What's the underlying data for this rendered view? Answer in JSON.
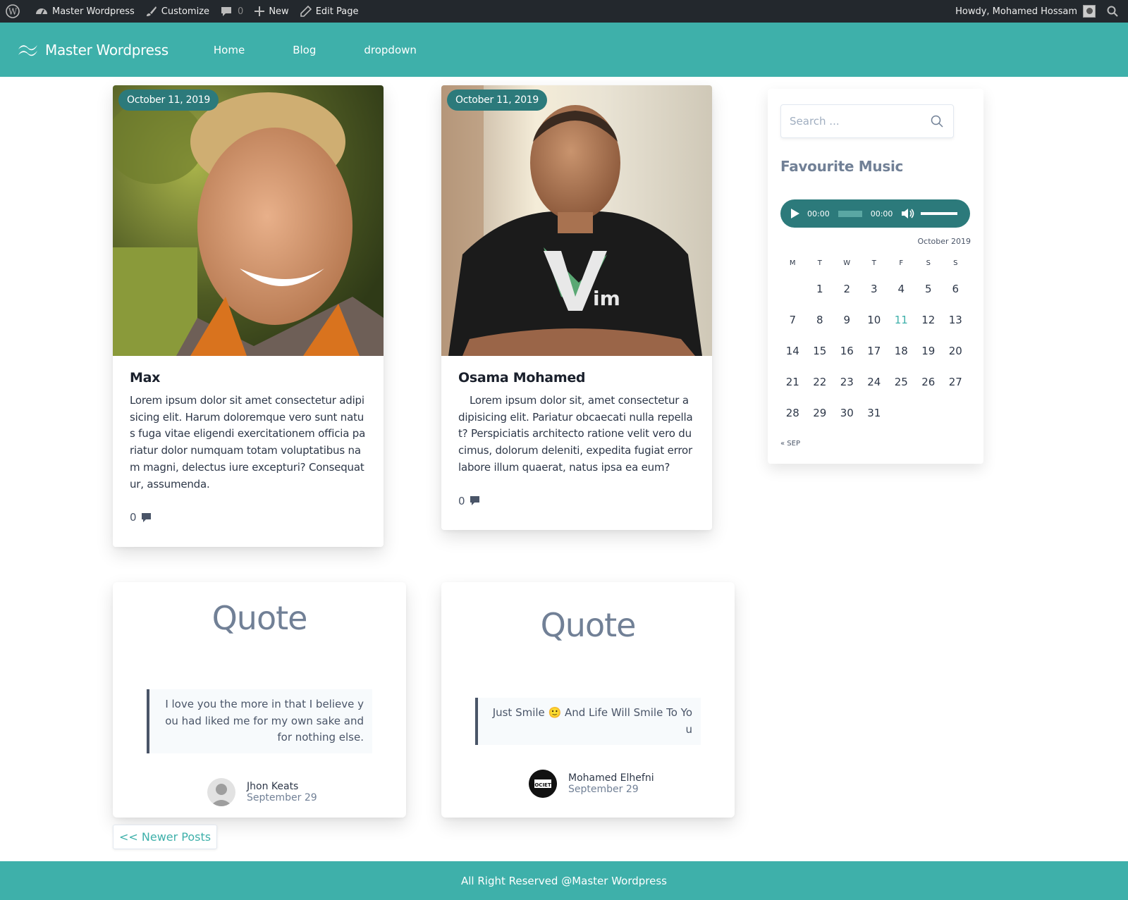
{
  "adminbar": {
    "site_name": "Master Wordpress",
    "customize": "Customize",
    "comments_count": "0",
    "new": "New",
    "edit_page": "Edit Page",
    "howdy": "Howdy, Mohamed Hossam"
  },
  "header": {
    "brand": "Master Wordpress",
    "nav": [
      "Home",
      "Blog",
      "dropdown"
    ]
  },
  "posts": [
    {
      "date": "October 11, 2019",
      "title": "Max",
      "text": "Lorem ipsum dolor sit amet consectetur adipisicing elit. Harum doloremque vero sunt natus fuga vitae eligendi exercitationem officia pariatur dolor numquam totam voluptatibus nam magni, delectus iure excepturi? Consequatur, assumenda.",
      "comments": "0"
    },
    {
      "date": "October 11, 2019",
      "title": "Osama Mohamed",
      "text": "Lorem ipsum dolor sit, amet consectetur adipisicing elit. Pariatur obcaecati nulla repellat? Perspiciatis architecto ratione velit vero ducimus, dolorum deleniti, expedita fugiat error labore illum quaerat, natus ipsa ea eum?",
      "comments": "0"
    }
  ],
  "quotes": [
    {
      "title": "Quote",
      "text": "I love you the more in that I believe you had liked me for my own sake and for nothing else.",
      "author": "Jhon Keats",
      "date": "September 29"
    },
    {
      "title": "Quote",
      "text": "Just Smile 🙂 And Life Will Smile To You",
      "author": "Mohamed Elhefni",
      "date": "September 29",
      "avatar_text": "SOCIETY"
    }
  ],
  "sidebar": {
    "search_placeholder": "Search ...",
    "music_title": "Favourite Music",
    "player": {
      "current": "00:00",
      "duration": "00:00"
    },
    "calendar": {
      "caption": "October 2019",
      "weekdays": [
        "M",
        "T",
        "W",
        "T",
        "F",
        "S",
        "S"
      ],
      "weeks": [
        [
          "",
          "1",
          "2",
          "3",
          "4",
          "5",
          "6"
        ],
        [
          "7",
          "8",
          "9",
          "10",
          "11",
          "12",
          "13"
        ],
        [
          "14",
          "15",
          "16",
          "17",
          "18",
          "19",
          "20"
        ],
        [
          "21",
          "22",
          "23",
          "24",
          "25",
          "26",
          "27"
        ],
        [
          "28",
          "29",
          "30",
          "31",
          "",
          "",
          ""
        ]
      ],
      "today": "11",
      "prev": "« SEP"
    }
  },
  "pagination": {
    "newer": "<< Newer Posts"
  },
  "footer": {
    "text": "All Right Reserved @Master Wordpress"
  },
  "colors": {
    "primary": "#3eb0aa",
    "accent_dark": "#2c7a7b",
    "adminbar": "#23282d"
  }
}
